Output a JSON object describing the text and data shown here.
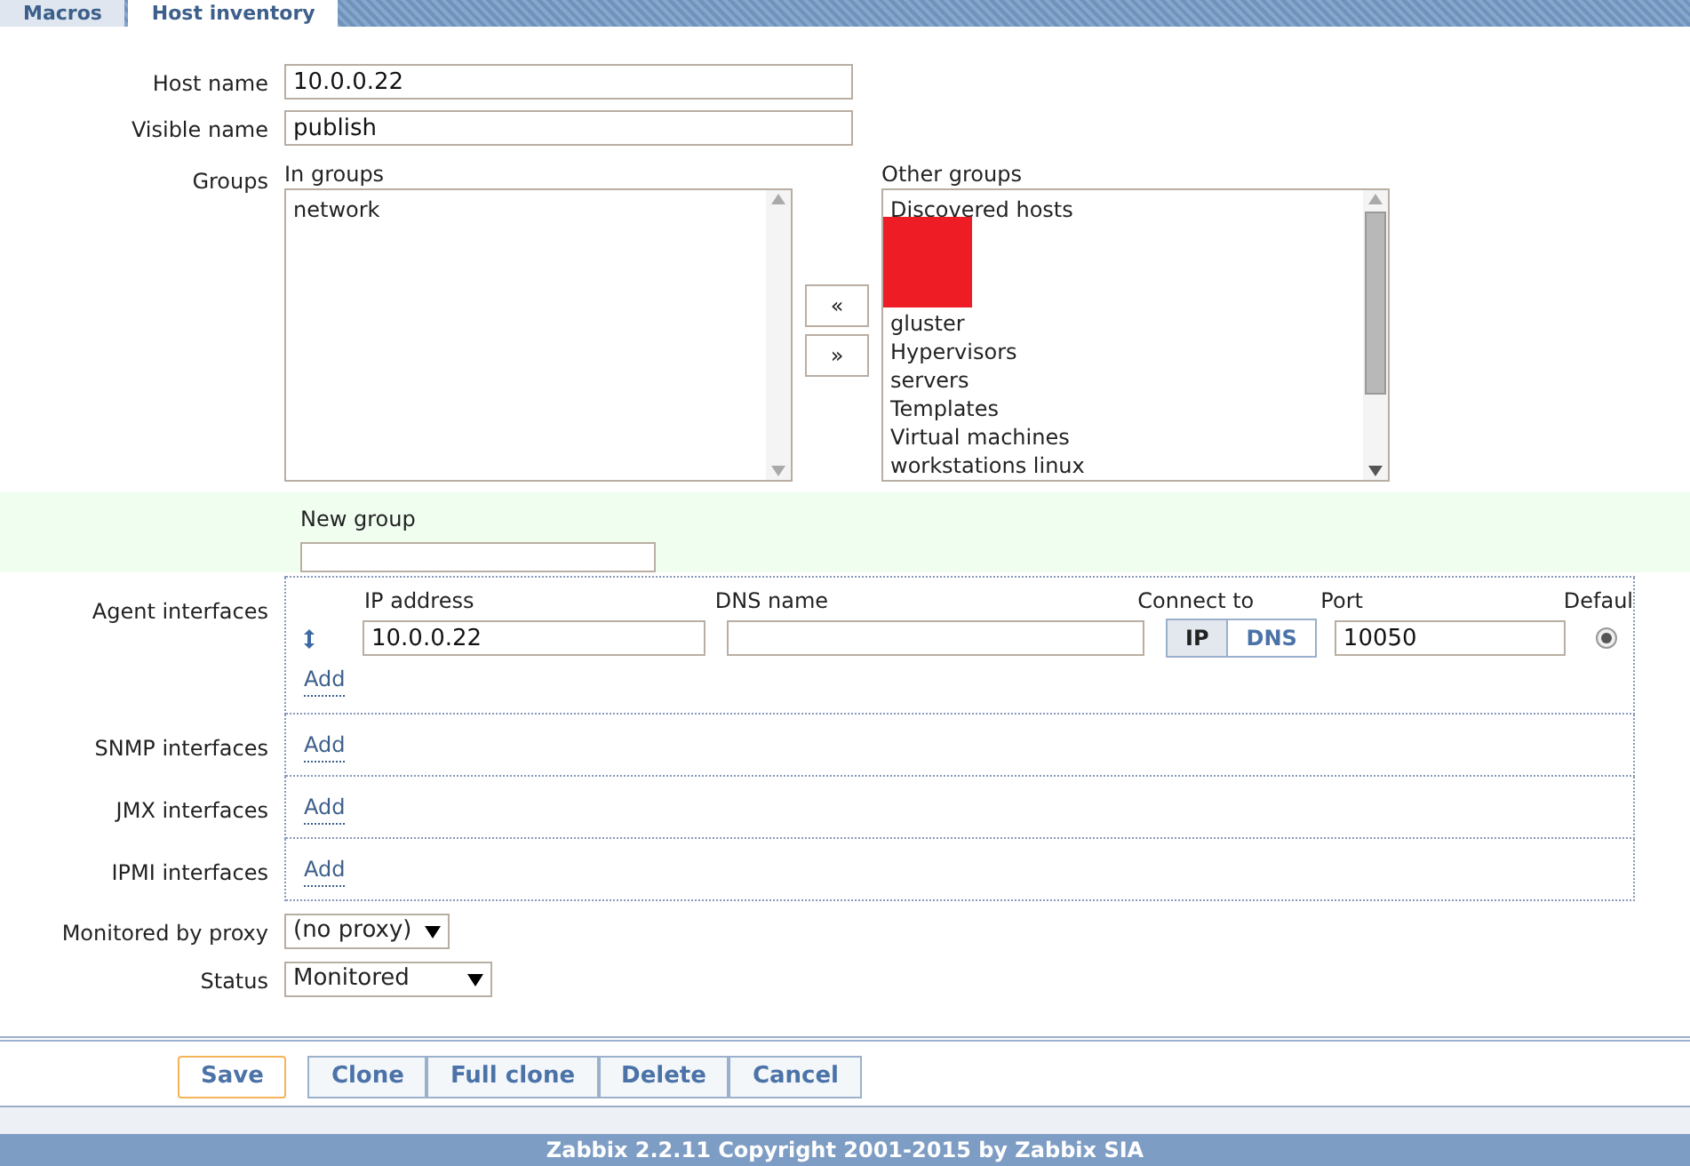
{
  "tabs": [
    {
      "label": "Macros",
      "selected": false
    },
    {
      "label": "Host inventory",
      "selected": true
    }
  ],
  "host_name": {
    "label": "Host name",
    "value": "10.0.0.22"
  },
  "visible_name": {
    "label": "Visible name",
    "value": "publish"
  },
  "groups": {
    "label": "Groups",
    "in_title": "In groups",
    "in_items": [
      "network"
    ],
    "other_title": "Other groups",
    "other_items": [
      {
        "label": "Discovered hosts",
        "redacted": false
      },
      {
        "redacted": true
      },
      {
        "redacted": true
      },
      {
        "redacted": true
      },
      {
        "label": "gluster",
        "redacted": false
      },
      {
        "label": "Hypervisors",
        "redacted": false
      },
      {
        "label": "servers",
        "redacted": false
      },
      {
        "label": "Templates",
        "redacted": false
      },
      {
        "label": "Virtual machines",
        "redacted": false
      },
      {
        "label": "workstations linux",
        "redacted": false
      }
    ],
    "move_left": "«",
    "move_right": "»"
  },
  "new_group": {
    "label": "New group"
  },
  "agent_interfaces": {
    "label": "Agent interfaces",
    "headers": [
      "IP address",
      "DNS name",
      "Connect to",
      "Port",
      "Defaul"
    ],
    "rows": [
      {
        "ip": "10.0.0.22",
        "dns": "",
        "connect": [
          {
            "label": "IP",
            "selected": true
          },
          {
            "label": "DNS",
            "selected": false
          }
        ],
        "port": "10050",
        "default": true
      }
    ],
    "add": "Add"
  },
  "other_interfaces": [
    {
      "label": "SNMP interfaces",
      "add": "Add"
    },
    {
      "label": "JMX interfaces",
      "add": "Add"
    },
    {
      "label": "IPMI interfaces",
      "add": "Add"
    }
  ],
  "proxy": {
    "label": "Monitored by proxy",
    "value": "(no proxy)"
  },
  "status": {
    "label": "Status",
    "value": "Monitored"
  },
  "buttons": [
    {
      "label": "Save",
      "kind": "primary"
    },
    {
      "label": "Clone",
      "kind": "group"
    },
    {
      "label": "Full clone",
      "kind": "group"
    },
    {
      "label": "Delete",
      "kind": "group"
    },
    {
      "label": "Cancel",
      "kind": "group"
    }
  ],
  "footer": "Zabbix 2.2.11 Copyright 2001-2015 by Zabbix SIA"
}
